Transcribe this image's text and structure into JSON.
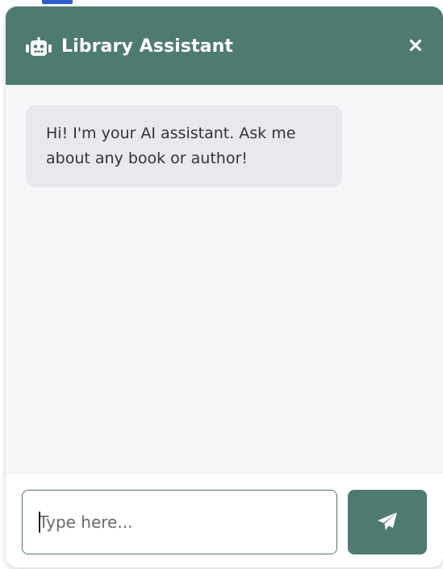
{
  "header": {
    "title": "Library Assistant",
    "robot_icon": "robot-icon",
    "close_icon": "close-icon",
    "close_glyph": "×"
  },
  "messages": [
    {
      "sender": "bot",
      "text": "Hi! I'm your AI assistant. Ask me about any book or author!"
    }
  ],
  "input": {
    "placeholder": "Type here...",
    "value": ""
  },
  "send_button": {
    "icon": "paper-plane-icon"
  },
  "colors": {
    "accent": "#4e7b71",
    "bot_bubble": "#e7e9ec",
    "background": "#f5f7f9"
  }
}
